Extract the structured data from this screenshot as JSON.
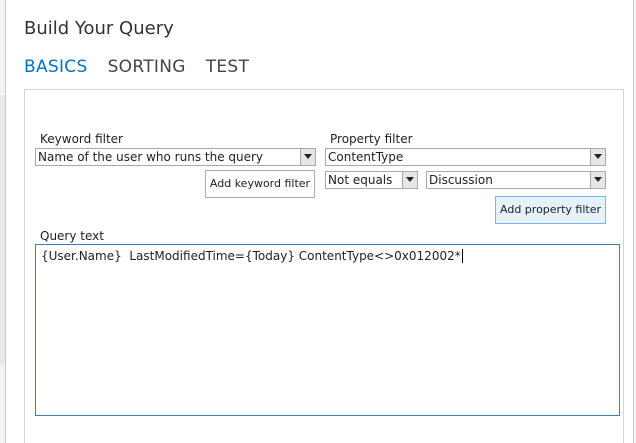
{
  "dialog": {
    "title": "Build Your Query"
  },
  "tabs": [
    {
      "label": "BASICS",
      "active": true
    },
    {
      "label": "SORTING",
      "active": false
    },
    {
      "label": "TEST",
      "active": false
    }
  ],
  "keyword_filter": {
    "label": "Keyword filter",
    "selected": "Name of the user who runs the query",
    "add_button": "Add keyword filter"
  },
  "property_filter": {
    "label": "Property filter",
    "property": "ContentType",
    "operator": "Not equals",
    "value": "Discussion",
    "add_button": "Add property filter"
  },
  "query": {
    "label": "Query text",
    "text": "{User.Name}  LastModifiedTime={Today} ContentType<>0x012002*"
  },
  "colors": {
    "accent": "#0072c6",
    "focus_border": "#3a7fb8",
    "button_hover": "#e5f1fb"
  }
}
